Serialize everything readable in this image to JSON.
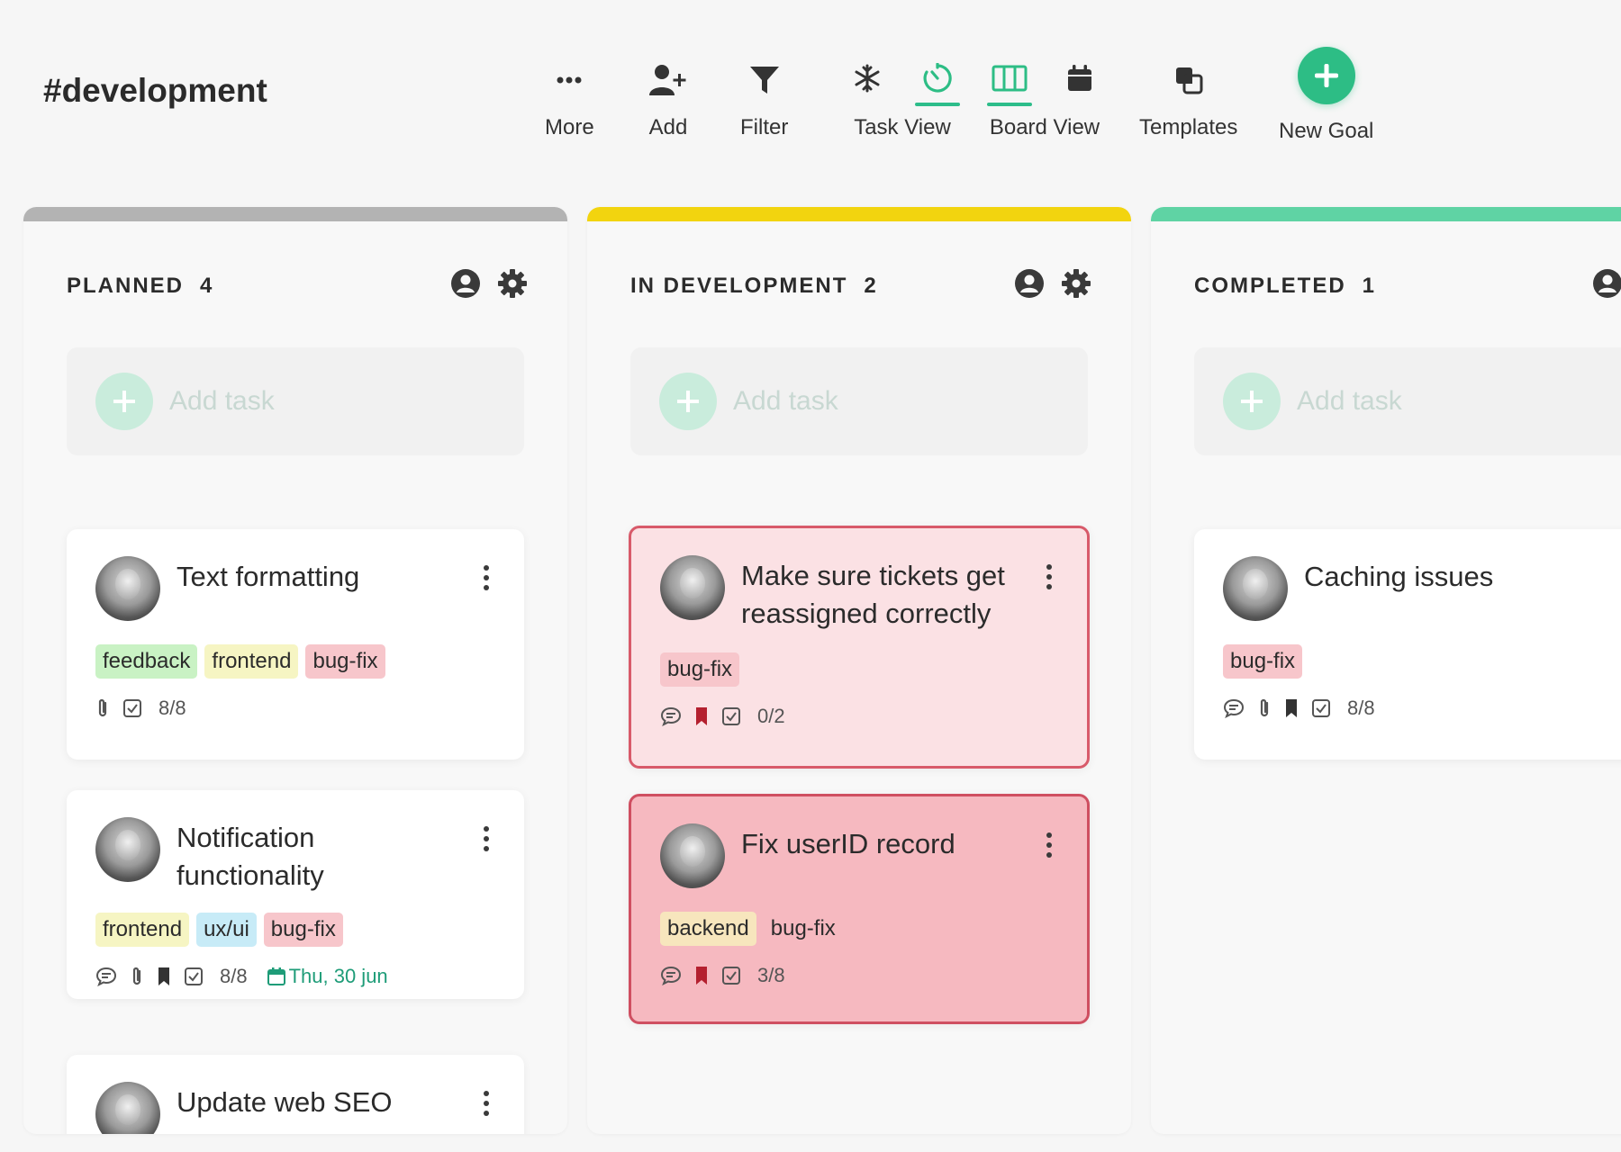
{
  "header": {
    "channel": "#development"
  },
  "toolbar": {
    "more": "More",
    "add": "Add",
    "filter": "Filter",
    "task_view": "Task View",
    "board_view": "Board View",
    "templates": "Templates",
    "new_goal": "New Goal"
  },
  "colors": {
    "accent": "#2dbd85",
    "planned_bar": "#b3b3b3",
    "dev_bar": "#f2d40f",
    "done_bar": "#5fd3a4"
  },
  "columns": [
    {
      "title": "PLANNED",
      "count": "4",
      "add_task": "Add task"
    },
    {
      "title": "IN DEVELOPMENT",
      "count": "2",
      "add_task": "Add task"
    },
    {
      "title": "COMPLETED",
      "count": "1",
      "add_task": "Add task"
    }
  ],
  "cards": {
    "text_formatting": {
      "title": "Text formatting",
      "tags": [
        "feedback",
        "frontend",
        "bug-fix"
      ],
      "checklist": "8/8"
    },
    "notification": {
      "title": "Notification functionality",
      "tags": [
        "frontend",
        "ux/ui",
        "bug-fix"
      ],
      "checklist": "8/8",
      "date": "Thu, 30 jun"
    },
    "update_seo": {
      "title": "Update web SEO"
    },
    "tickets": {
      "title": "Make sure tickets get reassigned correctly",
      "tags": [
        "bug-fix"
      ],
      "checklist": "0/2"
    },
    "userid": {
      "title": "Fix userID record",
      "tags": [
        "backend",
        "bug-fix"
      ],
      "checklist": "3/8"
    },
    "caching": {
      "title": "Caching issues",
      "tags": [
        "bug-fix"
      ],
      "checklist": "8/8"
    }
  }
}
